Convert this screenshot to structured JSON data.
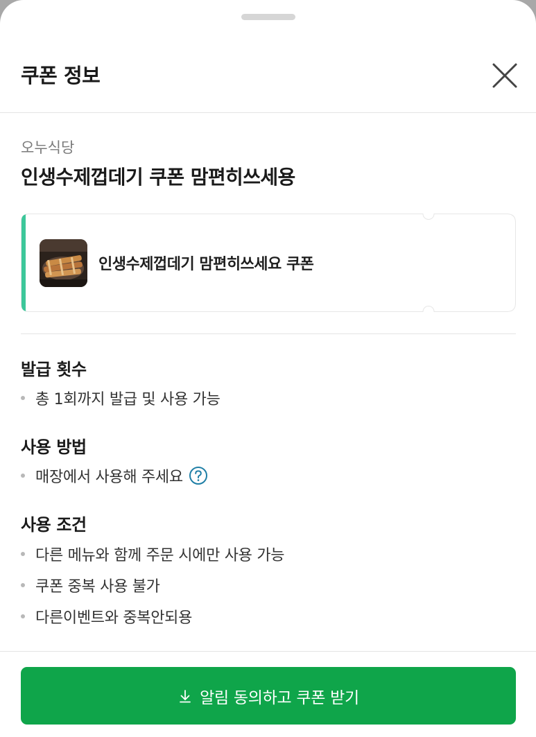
{
  "header": {
    "title": "쿠폰 정보",
    "close_icon": "close-icon"
  },
  "coupon": {
    "store_name": "오누식당",
    "title": "인생수제껍데기 쿠폰 맘편히쓰세용",
    "card_label": "인생수제껍데기 맘편히쓰세요 쿠폰",
    "accent_color": "#3cc79a"
  },
  "sections": [
    {
      "title": "발급 횟수",
      "items": [
        "총 1회까지 발급 및 사용 가능"
      ]
    },
    {
      "title": "사용 방법",
      "items": [
        "매장에서 사용해 주세요"
      ],
      "help_icon": "question-circle-icon"
    },
    {
      "title": "사용 조건",
      "items": [
        "다른 메뉴와 함께 주문 시에만 사용 가능",
        "쿠폰 중복 사용 불가",
        "다른이벤트와 중복안되용"
      ]
    }
  ],
  "cta": {
    "label": "알림 동의하고 쿠폰 받기",
    "icon": "download-icon",
    "color": "#0fa54a"
  }
}
